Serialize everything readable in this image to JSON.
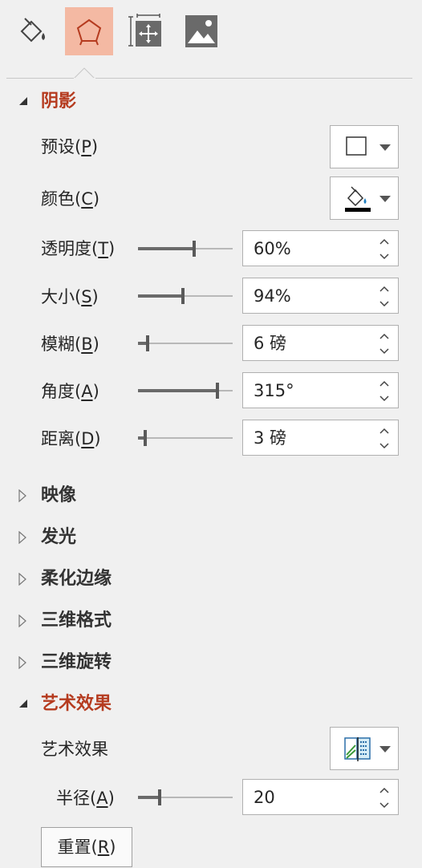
{
  "tabs": [
    {
      "icon": "fill-line-icon",
      "active": false
    },
    {
      "icon": "effects-icon",
      "active": true
    },
    {
      "icon": "size-properties-icon",
      "active": false
    },
    {
      "icon": "picture-icon",
      "active": false
    }
  ],
  "shadow": {
    "title": "阴影",
    "preset": {
      "label": "预设",
      "key": "P"
    },
    "color": {
      "label": "颜色",
      "key": "C"
    },
    "transparency": {
      "label": "透明度",
      "key": "T",
      "value": "60%",
      "level": 0.6
    },
    "size": {
      "label": "大小",
      "key": "S",
      "value": "94%",
      "level": 0.47
    },
    "blur": {
      "label": "模糊",
      "key": "B",
      "value": "6 磅",
      "level": 0.06
    },
    "angle": {
      "label": "角度",
      "key": "A",
      "value": "315°",
      "level": 0.875
    },
    "distance": {
      "label": "距离",
      "key": "D",
      "value": "3 磅",
      "level": 0.03
    }
  },
  "collapsed_sections": [
    "映像",
    "发光",
    "柔化边缘",
    "三维格式",
    "三维旋转"
  ],
  "artistic": {
    "title": "艺术效果",
    "effect_label": "艺术效果",
    "radius": {
      "label": "半径",
      "key": "A",
      "value": "20",
      "level": 0.2
    },
    "reset": {
      "label": "重置",
      "key": "R"
    }
  },
  "colors": {
    "accent": "#b53b1f",
    "active_tab": "#f4b9a3"
  }
}
